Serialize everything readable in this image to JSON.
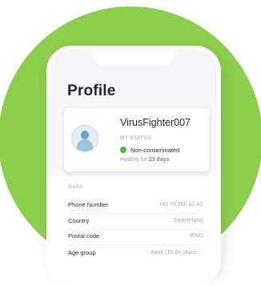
{
  "profile": {
    "title": "Profile",
    "username": "VirusFighter007",
    "status_label": "MY STATUS:",
    "status": "Non-contaminated",
    "status_color": "#55b533",
    "healthy_prefix": "Healthy for",
    "healthy_days": "23 days"
  },
  "data_section": {
    "label": "DATA",
    "rows": [
      {
        "key": "Phone Number",
        "value": "+41 79 260 82 43"
      },
      {
        "key": "Country",
        "value": "Switzerland"
      },
      {
        "key": "Postal code",
        "value": "8000"
      },
      {
        "key": "Age group",
        "value": "Adult (18-6h years ..."
      }
    ]
  },
  "colors": {
    "accent_green": "#8ccf4d"
  }
}
